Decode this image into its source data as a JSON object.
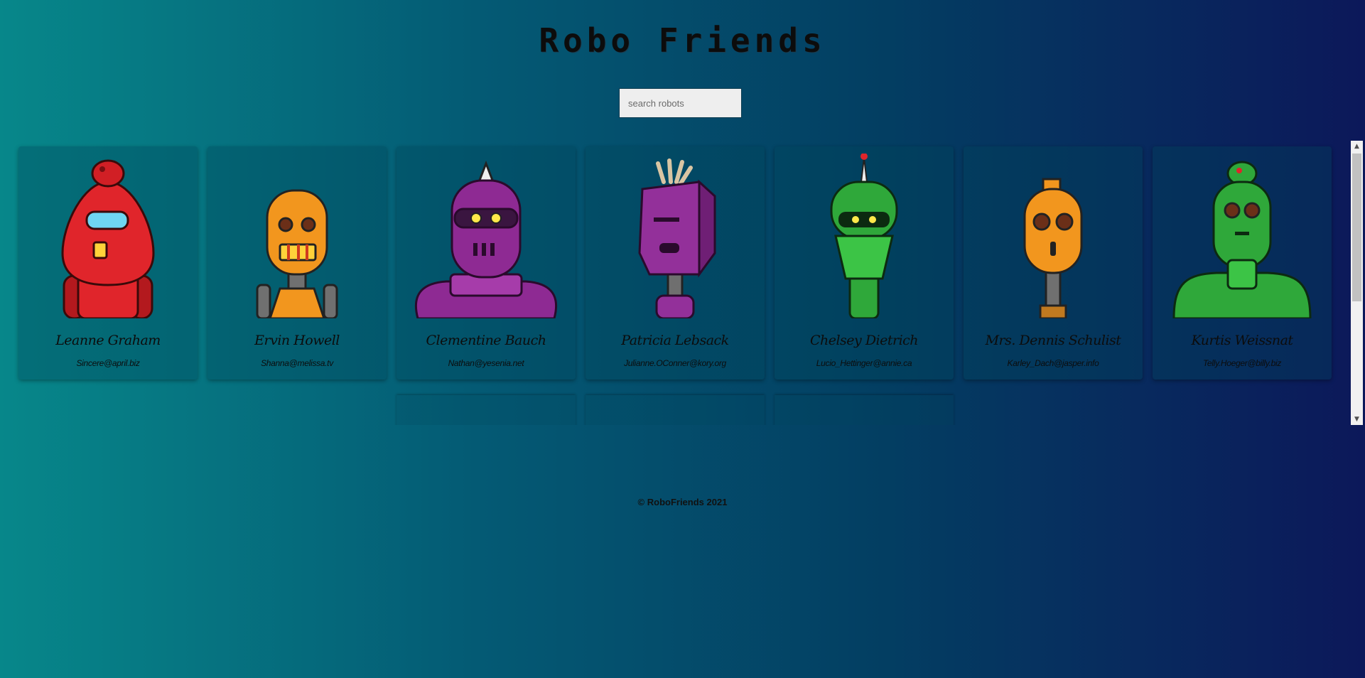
{
  "header": {
    "title": "Robo Friends"
  },
  "search": {
    "placeholder": "search robots"
  },
  "robots": [
    {
      "name": "Leanne Graham",
      "email": "Sincere@april.biz",
      "color": "#e0252b"
    },
    {
      "name": "Ervin Howell",
      "email": "Shanna@melissa.tv",
      "color": "#f2961e"
    },
    {
      "name": "Clementine Bauch",
      "email": "Nathan@yesenia.net",
      "color": "#8e2a93"
    },
    {
      "name": "Patricia Lebsack",
      "email": "Julianne.OConner@kory.org",
      "color": "#93309a"
    },
    {
      "name": "Chelsey Dietrich",
      "email": "Lucio_Hettinger@annie.ca",
      "color": "#2fa83a"
    },
    {
      "name": "Mrs. Dennis Schulist",
      "email": "Karley_Dach@jasper.info",
      "color": "#f2961e"
    },
    {
      "name": "Kurtis Weissnat",
      "email": "Telly.Hoeger@billy.biz",
      "color": "#2fa83a"
    }
  ],
  "footer": {
    "text": "© RoboFriends 2021"
  }
}
